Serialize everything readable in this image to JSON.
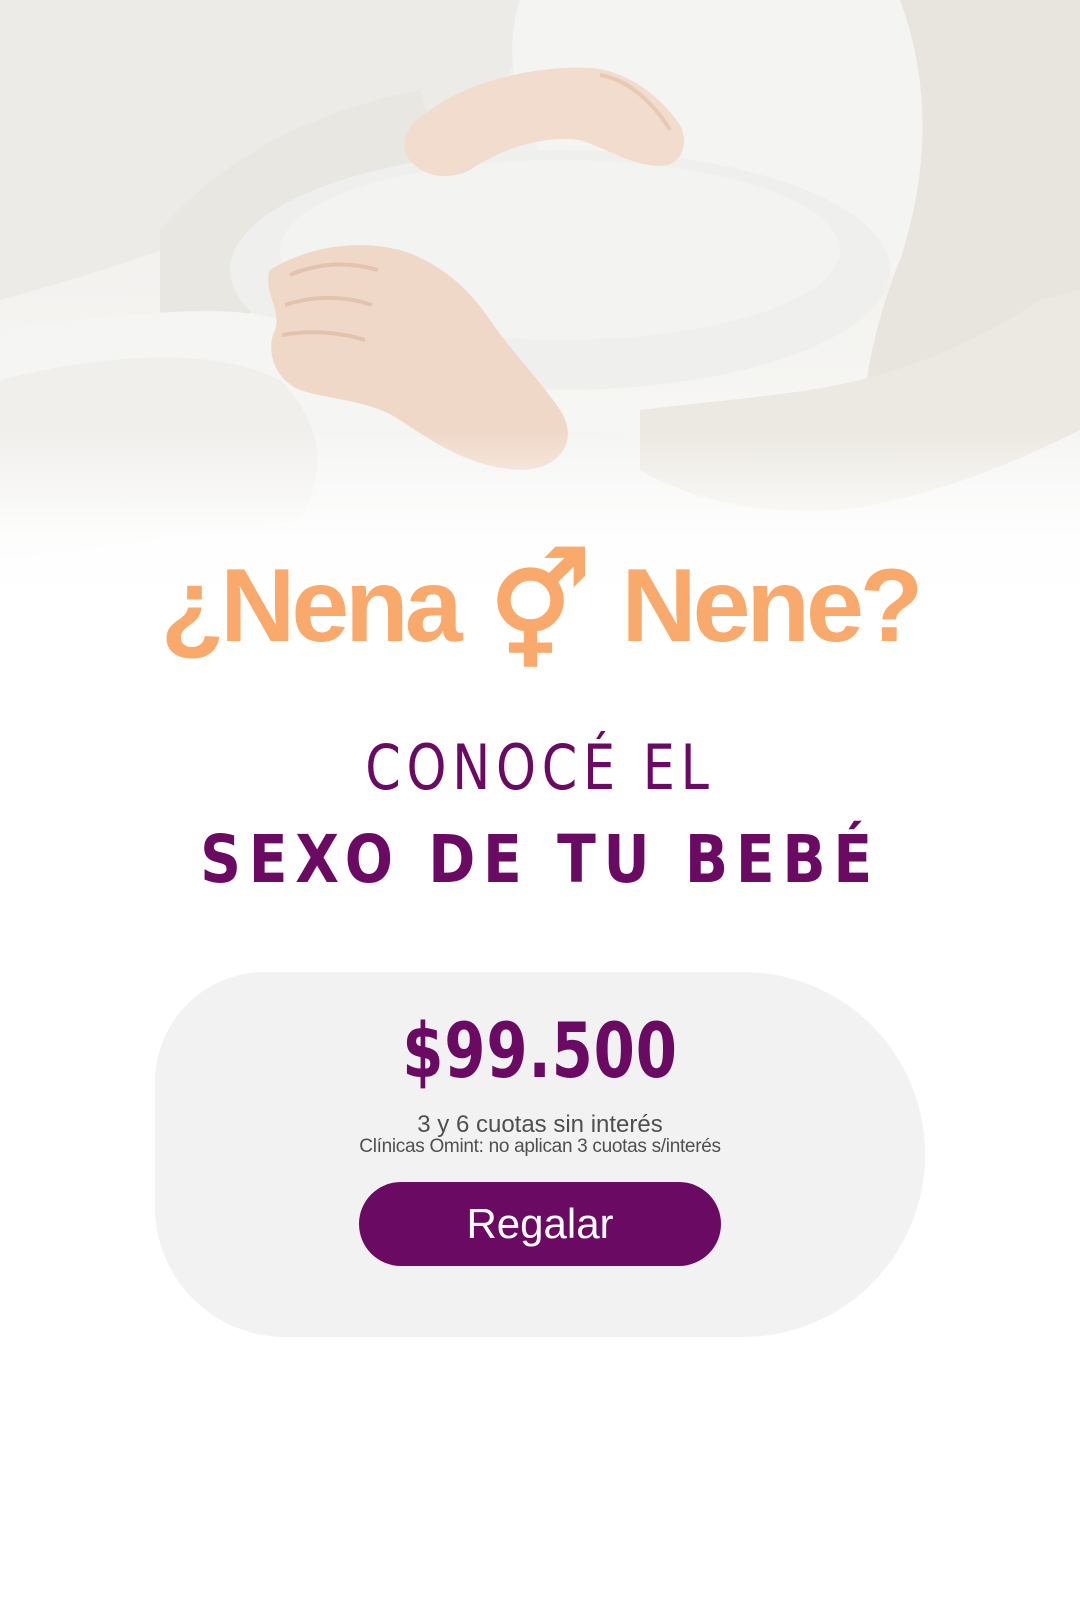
{
  "hero": {
    "image_subject": "pregnant-woman-photo"
  },
  "headline": {
    "part1": "¿Nena",
    "symbol": "⚥",
    "part2": "Nene?",
    "color": "#f9a96b"
  },
  "subtitle": {
    "line1": "CONOCÉ EL",
    "line2": "SEXO DE TU BEBÉ",
    "color": "#6b0a63"
  },
  "offer": {
    "price": "$99.500",
    "installments": "3 y 6 cuotas sin interés",
    "note": "Clínicas Omint: no aplican 3 cuotas s/interés",
    "card_color": "#f2f2f2"
  },
  "cta": {
    "label": "Regalar",
    "color": "#6b0a63"
  }
}
